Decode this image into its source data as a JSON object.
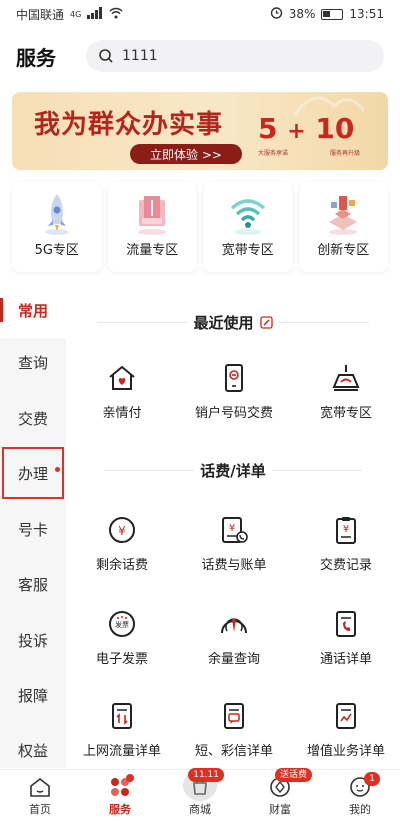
{
  "status_bar": {
    "carrier": "中国联通",
    "signal": "4G",
    "battery": "38%",
    "time": "13:51"
  },
  "header": {
    "title": "服务",
    "search_value": "1111"
  },
  "banner": {
    "title": "我为群众办实事",
    "button": "立即体验 >>",
    "num_a": "5",
    "plus": "+",
    "num_b": "10",
    "sub_a": "大服务承诺",
    "sub_b": "服务再升级",
    "brand_color": "#b3261e"
  },
  "zones": [
    {
      "label": "5G专区",
      "icon": "rocket-icon"
    },
    {
      "label": "流量专区",
      "icon": "data-package-icon"
    },
    {
      "label": "宽带专区",
      "icon": "wifi-icon"
    },
    {
      "label": "创新专区",
      "icon": "innovation-icon"
    }
  ],
  "sidebar": {
    "items": [
      {
        "label": "常用",
        "active": true
      },
      {
        "label": "查询"
      },
      {
        "label": "交费"
      },
      {
        "label": "办理",
        "highlight": true,
        "dot": true
      },
      {
        "label": "号卡"
      },
      {
        "label": "客服"
      },
      {
        "label": "投诉"
      },
      {
        "label": "报障"
      },
      {
        "label": "权益"
      }
    ]
  },
  "recent": {
    "title": "最近使用",
    "items": [
      {
        "label": "亲情付",
        "icon": "family-house-icon"
      },
      {
        "label": "销户号码交费",
        "icon": "phone-minus-icon"
      },
      {
        "label": "宽带专区",
        "icon": "router-icon"
      }
    ]
  },
  "bills": {
    "title": "话费/详单",
    "items": [
      {
        "label": "剩余话费",
        "icon": "yuan-coin-icon"
      },
      {
        "label": "话费与账单",
        "icon": "bill-phone-icon"
      },
      {
        "label": "交费记录",
        "icon": "clipboard-yuan-icon"
      },
      {
        "label": "电子发票",
        "icon": "invoice-icon",
        "icon_text": "发票"
      },
      {
        "label": "余量查询",
        "icon": "gauge-icon"
      },
      {
        "label": "通话详单",
        "icon": "call-detail-icon"
      },
      {
        "label": "上网流量详单",
        "icon": "data-detail-icon"
      },
      {
        "label": "短、彩信详单",
        "icon": "sms-detail-icon"
      },
      {
        "label": "增值业务详单",
        "icon": "vas-detail-icon"
      }
    ]
  },
  "bottom_nav": {
    "items": [
      {
        "label": "首页",
        "icon": "home-icon"
      },
      {
        "label": "服务",
        "icon": "service-icon",
        "active": true
      },
      {
        "label": "商城",
        "icon": "mall-icon",
        "badge": "11.11"
      },
      {
        "label": "财富",
        "icon": "wealth-icon",
        "badge": "送话费"
      },
      {
        "label": "我的",
        "icon": "profile-icon",
        "badge": "1"
      }
    ]
  },
  "colors": {
    "accent": "#c9271d",
    "badge": "#e02e24",
    "sidebar_bg": "#f6f6f6"
  }
}
